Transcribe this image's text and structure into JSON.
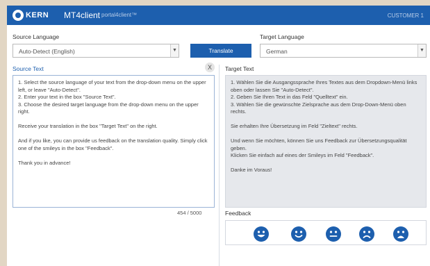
{
  "header": {
    "logo_text": "KERN",
    "app_name": "MT4client",
    "app_sub": "portal4client™",
    "customer": "CUSTOMER 1"
  },
  "source": {
    "language_label": "Source Language",
    "language_value": "Auto-Detect (English)",
    "title": "Source Text",
    "clear_label": "X",
    "paragraphs": [
      "1. Select the source language of your text from the drop-down menu on the upper left, or leave \"Auto-Detect\".\n2. Enter your text in the box \"Source Text\".\n3. Choose the desired target language from the drop-down menu on the upper right.",
      "Receive your translation in the box \"Target Text\" on the right.",
      "And if you like, you can provide us feedback on the translation quality. Simply click one of the smileys in the box \"Feedback\".",
      "Thank you in advance!"
    ],
    "counter": "454 / 5000"
  },
  "translate_label": "Translate",
  "target": {
    "language_label": "Target Language",
    "language_value": "German",
    "title": "Target Text",
    "paragraphs": [
      "1. Wählen Sie die Ausgangssprache Ihres Textes aus dem Dropdown-Menü links oben oder lassen Sie \"Auto-Detect\".\n2. Geben Sie Ihren Text in das Feld \"Quelltext\" ein.\n3. Wählen Sie die gewünschte Zielsprache aus dem Drop-Down-Menü oben rechts.",
      "Sie erhalten Ihre Übersetzung im Feld \"Zieltext\" rechts.",
      "Und wenn Sie möchten, können Sie uns Feedback zur Übersetzungsqualität geben.\nKlicken Sie einfach auf eines der Smileys im Feld \"Feedback\".",
      "Danke im Voraus!"
    ]
  },
  "feedback": {
    "title": "Feedback",
    "smileys": [
      "very-happy",
      "happy",
      "neutral",
      "sad",
      "very-sad"
    ]
  },
  "colors": {
    "brand": "#1d5fae",
    "target_bg": "#e6e8ec"
  }
}
